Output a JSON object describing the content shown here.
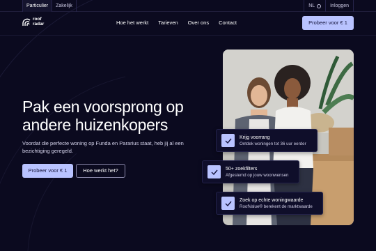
{
  "topbar": {
    "left_items": [
      "Particulier",
      "Zakelijk"
    ],
    "language": "NL",
    "login": "Inloggen"
  },
  "header": {
    "logo_line1": "roof",
    "logo_line2": "radar",
    "nav": [
      "Hoe het werkt",
      "Tarieven",
      "Over ons",
      "Contact"
    ],
    "cta": "Probeer voor € 1"
  },
  "hero": {
    "headline_line1": "Pak een voorsprong op",
    "headline_line2": "andere huizenkopers",
    "subtext": "Voordat die perfecte woning op Funda en Pararius staat, heb jij al een bezichtiging geregeld.",
    "primary_button": "Probeer voor € 1",
    "secondary_button": "Hoe werkt het?"
  },
  "features": [
    {
      "title": "Krijg voorrang",
      "subtitle": "Ontdek woningen tot 36 uur eerder"
    },
    {
      "title": "50+ zoekfilters",
      "subtitle": "Afgestemd op jouw woonwensen"
    },
    {
      "title": "Zoek op echte woningwaarde",
      "subtitle": "RoofValue® berekent de marktwaarde"
    }
  ],
  "icons": {
    "check": "check-icon",
    "globe": "globe-icon",
    "logo": "roofradar-logo-icon"
  },
  "colors": {
    "background": "#0b0a1f",
    "accent": "#b9c3ff",
    "card": "#0f0e2a"
  }
}
